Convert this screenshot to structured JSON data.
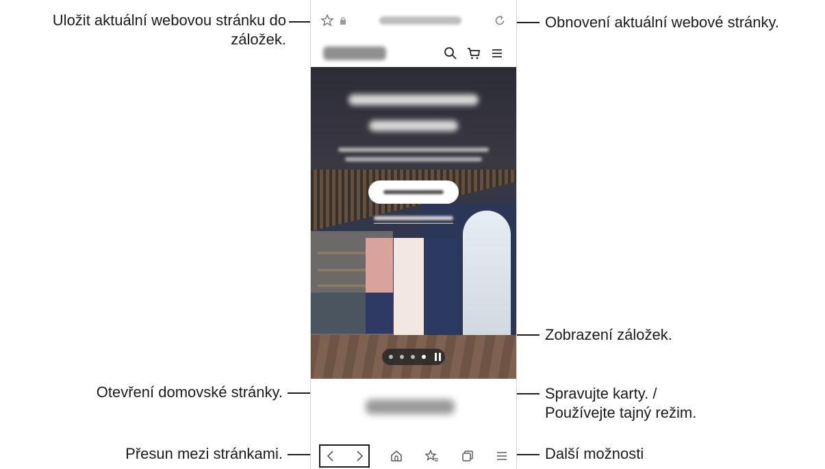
{
  "callouts": {
    "bookmark_save": "Uložit aktuální webovou stránku do záložek.",
    "refresh": "Obnovení aktuální webové stránky.",
    "view_bookmarks": "Zobrazení záložek.",
    "home": "Otevření domovské stránky.",
    "tabs_line1": "Spravujte karty. /",
    "tabs_line2": "Používejte tajný režim.",
    "navigate": "Přesun mezi stránkami.",
    "more": "Další možnosti"
  },
  "browser": {
    "icons": [
      "bookmark-star-icon",
      "lock-icon",
      "refresh-icon",
      "search-icon",
      "cart-icon",
      "menu-icon",
      "back-icon",
      "forward-icon",
      "home-icon",
      "bookmarks-icon",
      "tabs-icon",
      "more-options-icon"
    ]
  },
  "carousel": {
    "dots": 4,
    "active_index": 3
  },
  "colors": {
    "line": "#1a1a1a",
    "frame": "#d7d7d7"
  }
}
